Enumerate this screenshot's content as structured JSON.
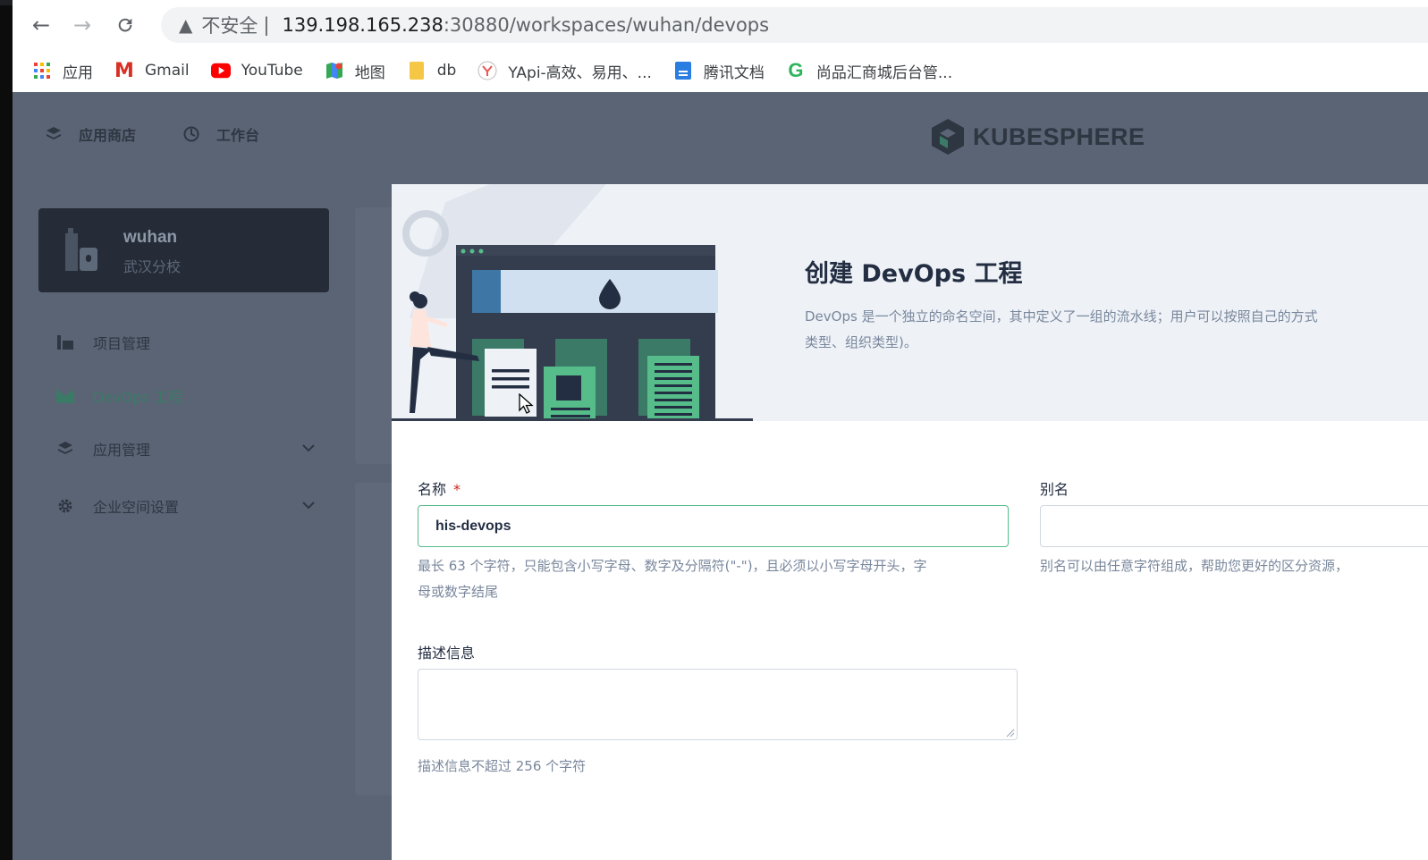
{
  "browser": {
    "url_warning_icon": "warning-triangle-icon",
    "url_insecure": "不安全",
    "url_sep": "|",
    "url_host": "139.198.165.238",
    "url_path": ":30880/workspaces/wuhan/devops",
    "bookmarks": [
      {
        "label": "应用",
        "icon": "apps-grid-icon"
      },
      {
        "label": "Gmail",
        "icon": "gmail-icon"
      },
      {
        "label": "YouTube",
        "icon": "youtube-icon"
      },
      {
        "label": "地图",
        "icon": "maps-icon"
      },
      {
        "label": "db",
        "icon": "folder-icon"
      },
      {
        "label": "YApi-高效、易用、...",
        "icon": "yapi-icon"
      },
      {
        "label": "腾讯文档",
        "icon": "tencent-docs-icon"
      },
      {
        "label": "尚品汇商城后台管...",
        "icon": "g-icon"
      }
    ]
  },
  "header": {
    "nav": [
      {
        "label": "应用商店",
        "icon": "app-store-icon"
      },
      {
        "label": "工作台",
        "icon": "workbench-icon"
      }
    ],
    "logo_text": "KUBESPHERE"
  },
  "sidebar": {
    "workspace_name": "wuhan",
    "workspace_desc": "武汉分校",
    "items": [
      {
        "label": "项目管理",
        "icon": "project-icon",
        "active": false
      },
      {
        "label": "DevOps 工程",
        "icon": "devops-icon",
        "active": true
      },
      {
        "label": "应用管理",
        "icon": "app-manage-icon",
        "active": false,
        "expandable": true
      },
      {
        "label": "企业空间设置",
        "icon": "gear-icon",
        "active": false,
        "expandable": true
      }
    ]
  },
  "modal": {
    "title": "创建 DevOps 工程",
    "desc_line1": "DevOps 是一个独立的命名空间，其中定义了一组的流水线；用户可以按照自己的方式",
    "desc_line2": "类型、组织类型)。",
    "name_label": "名称",
    "name_required": "*",
    "name_value": "his-devops",
    "name_hint_line1": "最长 63 个字符，只能包含小写字母、数字及分隔符(\"-\")，且必须以小写字母开头，字",
    "name_hint_line2": "母或数字结尾",
    "alias_label": "别名",
    "alias_value": "",
    "alias_hint": "别名可以由任意字符组成，帮助您更好的区分资源，",
    "desc_label": "描述信息",
    "desc_value": "",
    "desc_hint": "描述信息不超过 256 个字符"
  },
  "colors": {
    "overlay": "#5b6475",
    "accent": "#55bc8a",
    "modal_header_bg": "#eef2f7"
  }
}
